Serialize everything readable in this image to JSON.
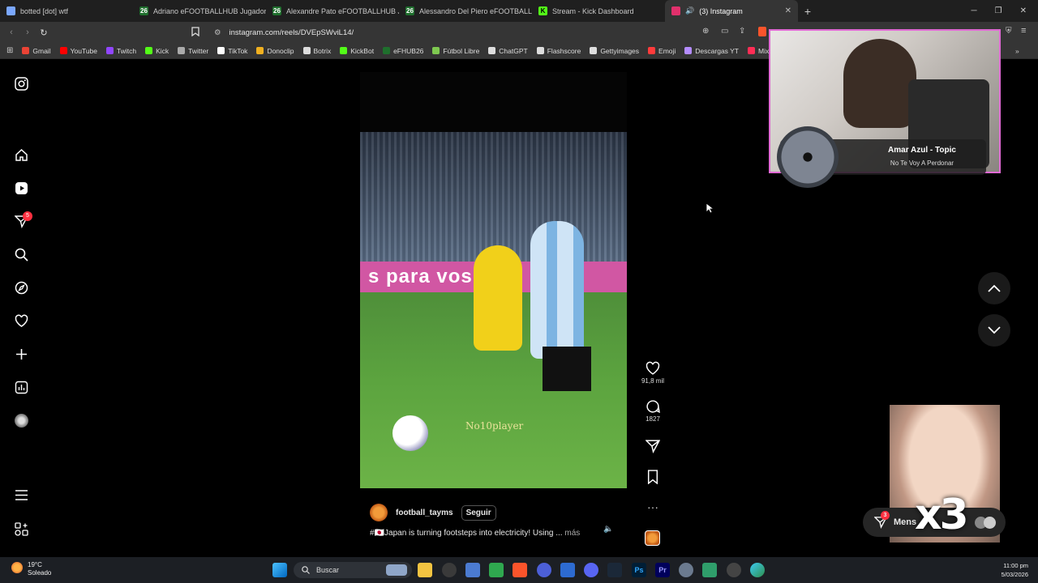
{
  "browser": {
    "tabs": [
      {
        "label": "botted [dot] wtf",
        "icon_color": "#7aa7ff",
        "active": false
      },
      {
        "label": "Adriano eFOOTBALLHUB Jugadores",
        "icon_text": "26",
        "icon_color": "#1f6f2d",
        "active": false
      },
      {
        "label": "Alexandre Pato eFOOTBALLHUB Juga",
        "icon_text": "26",
        "icon_color": "#1f6f2d",
        "active": false
      },
      {
        "label": "Alessandro Del Piero eFOOTBALLHU",
        "icon_text": "26",
        "icon_color": "#1f6f2d",
        "active": false
      },
      {
        "label": "Stream - Kick Dashboard",
        "icon_text": "K",
        "icon_color": "#53fc18",
        "active": false
      },
      {
        "label": "(3) Instagram",
        "icon_color": "#e1306c",
        "active": true
      }
    ],
    "url": "instagram.com/reels/DVEpSWviL14/",
    "bookmarks": [
      {
        "label": "Gmail",
        "color": "#ea4335"
      },
      {
        "label": "YouTube",
        "color": "#ff0000"
      },
      {
        "label": "Twitch",
        "color": "#9146ff"
      },
      {
        "label": "Kick",
        "color": "#53fc18"
      },
      {
        "label": "Twitter",
        "color": "#aaaaaa"
      },
      {
        "label": "TikTok",
        "color": "#ffffff"
      },
      {
        "label": "Donoclip",
        "color": "#f0b020"
      },
      {
        "label": "Botrix",
        "color": "#dddddd"
      },
      {
        "label": "KickBot",
        "color": "#53fc18"
      },
      {
        "label": "eFHUB26",
        "color": "#1f6f2d"
      },
      {
        "label": "Fútbol Libre",
        "color": "#7ec850"
      },
      {
        "label": "ChatGPT",
        "color": "#dddddd"
      },
      {
        "label": "Flashscore",
        "color": "#dddddd"
      },
      {
        "label": "Gettyimages",
        "color": "#dddddd"
      },
      {
        "label": "Emoji",
        "color": "#ff3b3b"
      },
      {
        "label": "Descargas YT",
        "color": "#b48cff"
      },
      {
        "label": "Mix N",
        "color": "#ff2d55"
      }
    ]
  },
  "sidebar": {
    "notifications_badge": "5"
  },
  "reel": {
    "banner_text": "s para vos, ra a",
    "watermark": "No10player",
    "username": "football_tayms",
    "follow_label": "Seguir",
    "caption": "#🇯🇵Japan is turning footsteps into electricity! Using ...",
    "more_label": "más",
    "likes": "91,8 mil",
    "comments": "1827"
  },
  "overlay": {
    "music_title": "Amar Azul - Topic",
    "music_subtitle": "No Te Voy A Perdonar",
    "reaction_text": "x3",
    "messages_label": "Mens",
    "messages_badge": "3"
  },
  "taskbar": {
    "weather_temp": "19°C",
    "weather_desc": "Soleado",
    "search_label": "Buscar",
    "time": "11:00 pm",
    "date": "5/03/2026"
  }
}
